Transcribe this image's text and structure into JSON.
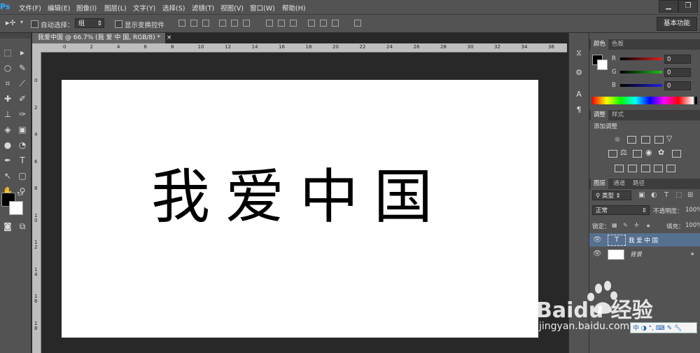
{
  "app": {
    "logo": "Ps"
  },
  "menu": [
    "文件(F)",
    "编辑(E)",
    "图像(I)",
    "图层(L)",
    "文字(Y)",
    "选择(S)",
    "滤镜(T)",
    "视图(V)",
    "窗口(W)",
    "帮助(H)"
  ],
  "options": {
    "auto_select_label": "自动选择：",
    "auto_select_value": "组",
    "show_transform_label": "显示变换控件",
    "workspace": "基本功能"
  },
  "document": {
    "tab_title": "我爱中国 @ 66.7% (我 爱 中 国, RGB/8) *",
    "tab_close": "×",
    "ruler_top": [
      "0",
      "2",
      "4",
      "6",
      "8",
      "10",
      "12",
      "14",
      "16",
      "18",
      "20",
      "22",
      "24",
      "26",
      "28",
      "30",
      "32",
      "34",
      "36"
    ],
    "ruler_left": [
      "0",
      "2",
      "4",
      "6",
      "8",
      "1\n0",
      "1\n2",
      "1\n4",
      "1\n6",
      "1\n8"
    ],
    "canvas_text": "我爱中国"
  },
  "color_panel": {
    "tabs": [
      "颜色",
      "色板"
    ],
    "r_label": "R",
    "g_label": "G",
    "b_label": "B",
    "r_value": "0",
    "g_value": "0",
    "b_value": "0",
    "colors": {
      "r": "#e02020",
      "g": "#20c020",
      "b": "#2020e0"
    }
  },
  "adjust_panel": {
    "tabs": [
      "调整",
      "样式"
    ],
    "title": "添加调整"
  },
  "layers_panel": {
    "tabs": [
      "图层",
      "通道",
      "路径"
    ],
    "kind_filter": "类型",
    "blend_mode": "正常",
    "opacity_label": "不透明度：",
    "opacity_value": "100%",
    "lock_label": "锁定：",
    "fill_label": "填充：",
    "fill_value": "100%",
    "layers": [
      {
        "name": "我 爱 中 国",
        "type": "text",
        "thumb": "T"
      },
      {
        "name": "背景",
        "type": "background"
      }
    ]
  },
  "watermark": {
    "brand": "Baidu 经验",
    "url": "jingyan.baidu.com"
  }
}
